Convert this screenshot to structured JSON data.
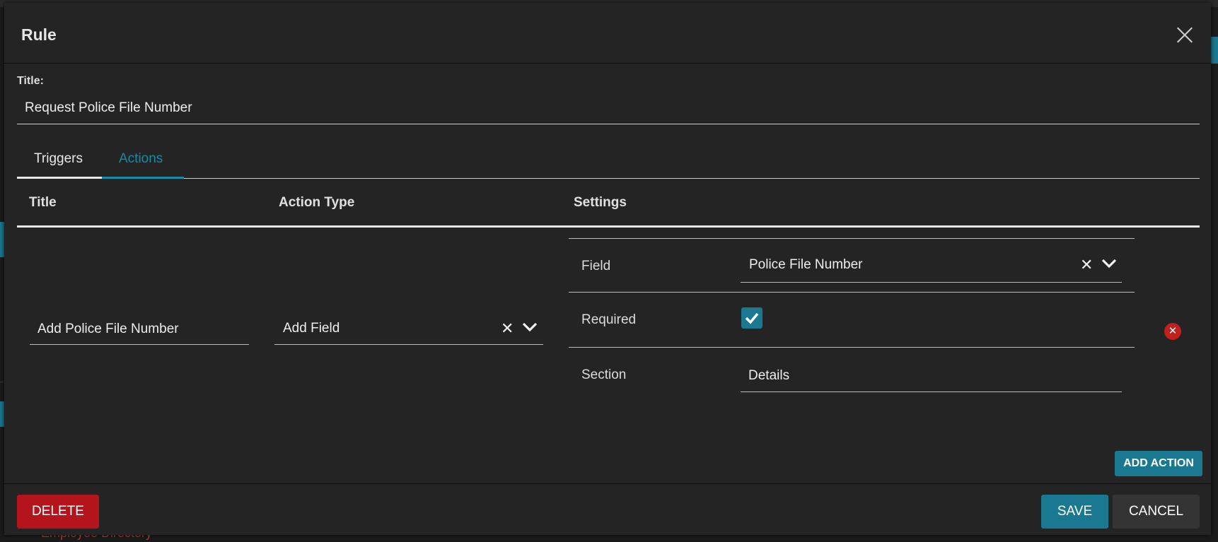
{
  "modal": {
    "title": "Rule",
    "title_label": "Title:",
    "title_value": "Request Police File Number"
  },
  "tabs": [
    {
      "label": "Triggers",
      "active": false
    },
    {
      "label": "Actions",
      "active": true
    }
  ],
  "table": {
    "headers": [
      "Title",
      "Action Type",
      "Settings"
    ],
    "row": {
      "title": "Add Police File Number",
      "action_type": "Add Field",
      "settings": {
        "field_label": "Field",
        "field_value": "Police File Number",
        "required_label": "Required",
        "required_checked": true,
        "section_label": "Section",
        "section_value": "Details"
      }
    }
  },
  "buttons": {
    "add_action": "ADD ACTION",
    "delete": "DELETE",
    "save": "SAVE",
    "cancel": "CANCEL"
  },
  "background": {
    "link_text": "Employee Directory"
  },
  "colors": {
    "accent": "#1a7891",
    "danger": "#b4151d",
    "surface": "#242424"
  }
}
